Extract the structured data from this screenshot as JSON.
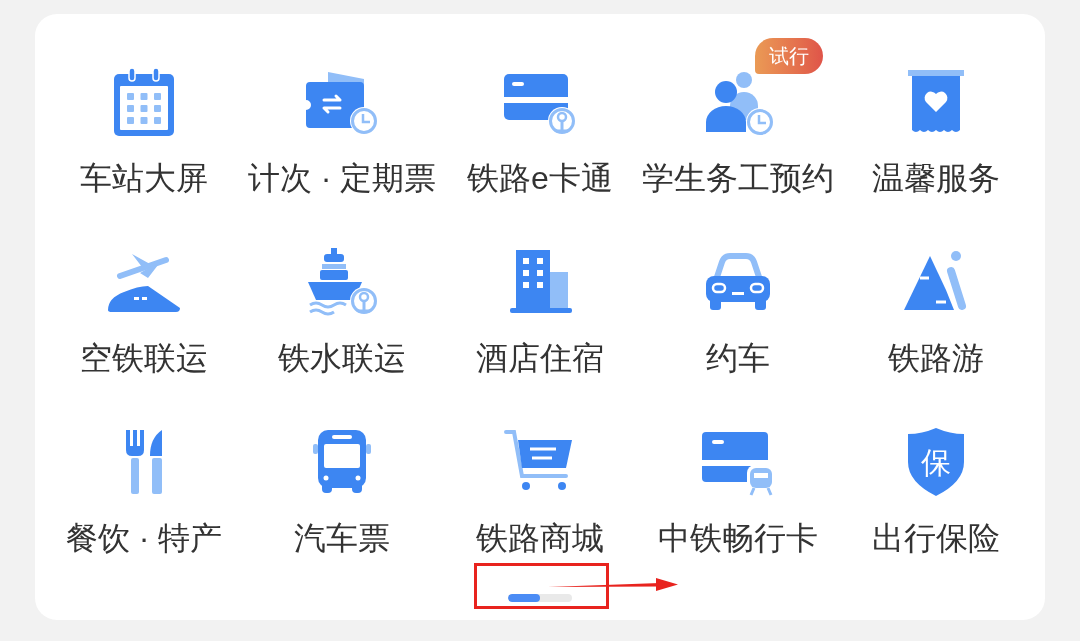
{
  "services": [
    {
      "label": "车站大屏"
    },
    {
      "label": "计次 · 定期票"
    },
    {
      "label": "铁路e卡通"
    },
    {
      "label": "学生务工预约",
      "badge": "试行"
    },
    {
      "label": "温馨服务"
    },
    {
      "label": "空铁联运"
    },
    {
      "label": "铁水联运"
    },
    {
      "label": "酒店住宿"
    },
    {
      "label": "约车"
    },
    {
      "label": "铁路游"
    },
    {
      "label": "餐饮 · 特产"
    },
    {
      "label": "汽车票"
    },
    {
      "label": "铁路商城"
    },
    {
      "label": "中铁畅行卡"
    },
    {
      "label": "出行保险",
      "icon_text": "保"
    }
  ]
}
